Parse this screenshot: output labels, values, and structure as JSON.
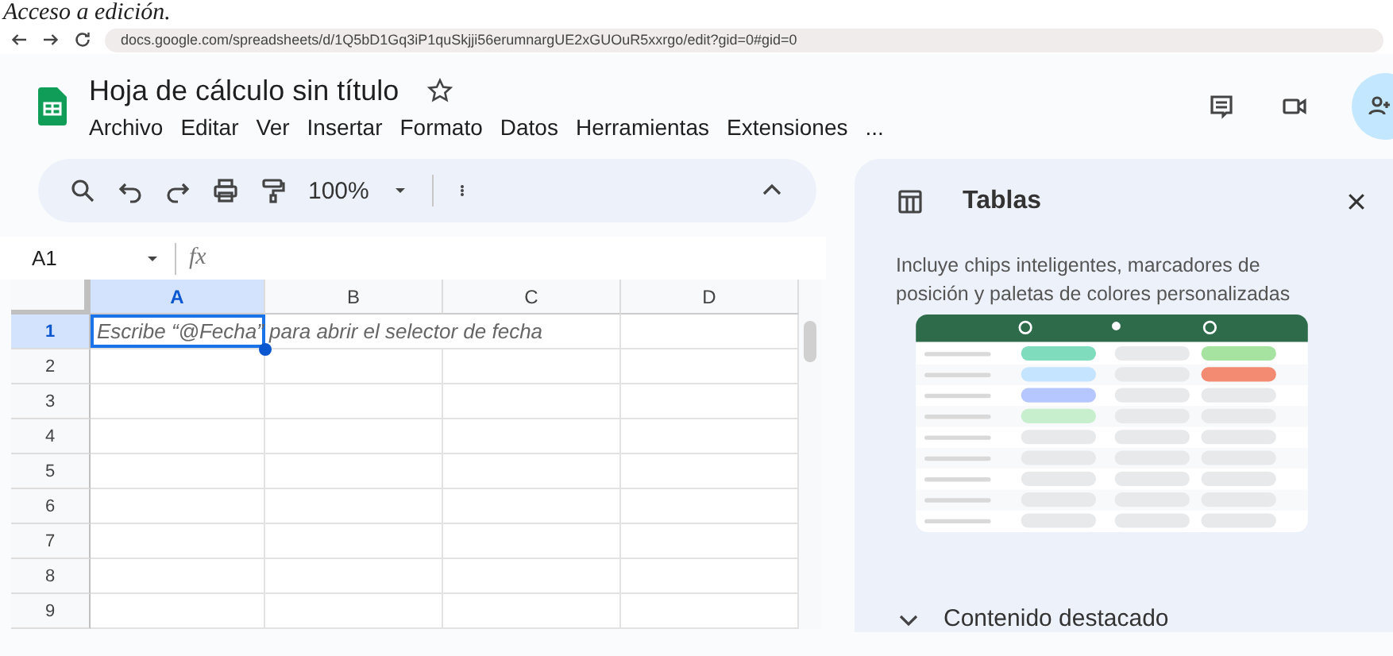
{
  "caption": "Acceso a edición.",
  "browser": {
    "url": "docs.google.com/spreadsheets/d/1Q5bD1Gq3iP1quSkjji56erumnargUE2xGUOuR5xxrgo/edit?gid=0#gid=0"
  },
  "document": {
    "title": "Hoja de cálculo sin título",
    "menus": [
      "Archivo",
      "Editar",
      "Ver",
      "Insertar",
      "Formato",
      "Datos",
      "Herramientas",
      "Extensiones",
      "..."
    ]
  },
  "toolbar": {
    "zoom": "100%"
  },
  "formula_bar": {
    "cell": "A1",
    "fx": "fx"
  },
  "columns": [
    {
      "label": "A",
      "selected": true
    },
    {
      "label": "B",
      "selected": false
    },
    {
      "label": "C",
      "selected": false
    },
    {
      "label": "D",
      "selected": false
    }
  ],
  "rows": [
    {
      "label": "1",
      "selected": true
    },
    {
      "label": "2",
      "selected": false
    },
    {
      "label": "3",
      "selected": false
    },
    {
      "label": "4",
      "selected": false
    },
    {
      "label": "5",
      "selected": false
    },
    {
      "label": "6",
      "selected": false
    },
    {
      "label": "7",
      "selected": false
    },
    {
      "label": "8",
      "selected": false
    },
    {
      "label": "9",
      "selected": false
    }
  ],
  "active_cell": {
    "hint": "Escribe “@Fecha” para abrir el selector de fecha"
  },
  "side_panel": {
    "title": "Tablas",
    "description": "Incluye chips inteligentes, marcadores de posición y paletas de colores personalizadas",
    "section": "Contenido destacado"
  }
}
